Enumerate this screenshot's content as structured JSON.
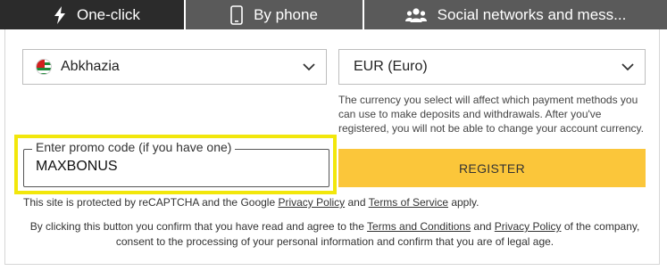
{
  "tabs": [
    {
      "label": "One-click",
      "icon": "lightning-icon"
    },
    {
      "label": "By phone",
      "icon": "phone-icon"
    },
    {
      "label": "Social networks and mess...",
      "icon": "users-icon"
    }
  ],
  "country": {
    "value": "Abkhazia",
    "icon": "abkhazia-flag-icon"
  },
  "currency": {
    "value": "EUR (Euro)"
  },
  "currency_note": "The currency you select will affect which payment methods you can use to make deposits and withdrawals. After you've registered, you will not be able to change your account currency.",
  "promo": {
    "label": "Enter promo code (if you have one)",
    "value": "MAXBONUS"
  },
  "register_label": "REGISTER",
  "captcha": {
    "before": "This site is protected by reCAPTCHA and the Google ",
    "privacy_link": "Privacy Policy",
    "and": " and ",
    "terms_link": "Terms of Service",
    "after": " apply."
  },
  "legal": {
    "part1": "By clicking this button you confirm that you have read and agree to the ",
    "terms_link": "Terms and Conditions",
    "and": " and ",
    "privacy_link": "Privacy Policy",
    "part2": " of the company, consent to the processing of your personal information and confirm that you are of legal age."
  },
  "colors": {
    "tab_active": "#2b2b2b",
    "tab_inactive": "#5a5a5a",
    "register_bg": "#fbc63a",
    "highlight": "#f2e70b"
  }
}
